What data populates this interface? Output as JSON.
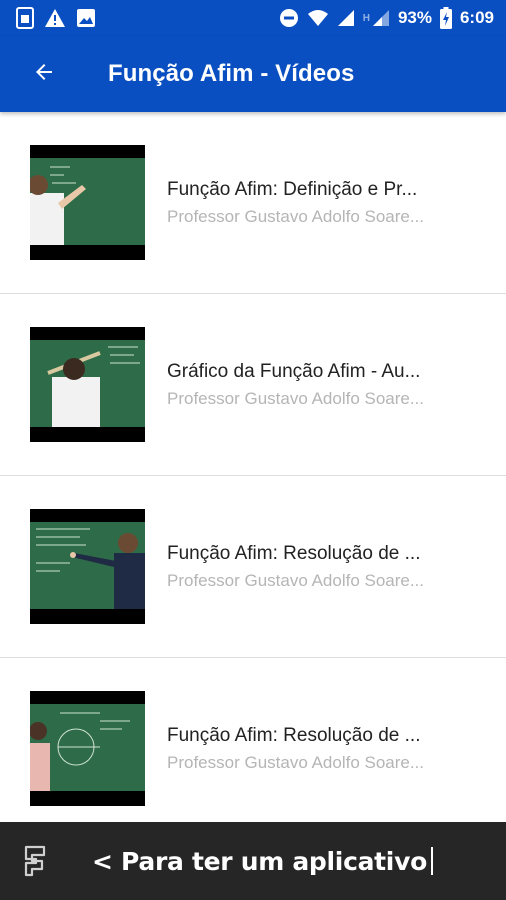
{
  "status_bar": {
    "battery": "93%",
    "time": "6:09",
    "network_h": "H"
  },
  "app_bar": {
    "title": "Função Afim - Vídeos"
  },
  "videos": [
    {
      "title": "Função Afim: Definição e Pr...",
      "author": "Professor Gustavo Adolfo Soare..."
    },
    {
      "title": "Gráfico da Função Afim - Au...",
      "author": "Professor Gustavo Adolfo Soare..."
    },
    {
      "title": "Função Afim: Resolução de ...",
      "author": "Professor Gustavo Adolfo Soare..."
    },
    {
      "title": "Função Afim: Resolução de ...",
      "author": "Professor Gustavo Adolfo Soare..."
    }
  ],
  "banner": {
    "text": "< Para ter um aplicativo"
  },
  "colors": {
    "primary": "#0a4fc2",
    "banner_bg": "#262626",
    "chalkboard": "#2e6b48"
  }
}
